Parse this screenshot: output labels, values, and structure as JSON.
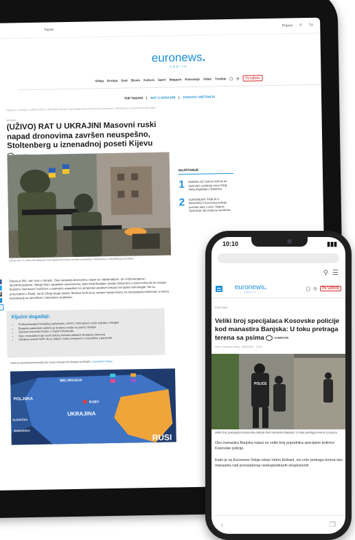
{
  "tablet": {
    "topbar": {
      "lang": "Srpski",
      "login": "Prijava",
      "search_icon": "search-icon",
      "tv": "TV"
    },
    "logo": {
      "text": "euronews",
      "sub": "SRBIJA"
    },
    "nav": [
      "Srbija",
      "Evropa",
      "Svet",
      "Biznis",
      "Kultura",
      "Sport",
      "Magazin",
      "Putovanja",
      "Video",
      "Tvrdnje"
    ],
    "nav_live": "TV UŽIVO",
    "tags": {
      "label": "TOP TAGOVI",
      "items": [
        "RAT U UKRAJINI",
        "KOSOVO I METOHIJA"
      ]
    },
    "breadcrumb": "Naslovna > Evropa > (UŽIVO) RAT U UKRAJINI Masovni ruski napad dronovima završen neuspešno, Stoltenberg u iznenadnoj poseti Kijevu",
    "category": "EVROPA",
    "title": "(UŽIVO) RAT U UKRAJINI Masovni ruski napad dronovima završen neuspešno, Stoltenberg u iznenadnoj poseti Kijevu",
    "comments": "KOMENTARI",
    "author": "Autor: Euronews Srbija",
    "hero_caption": "UŽIVO RAT U UKRAJINI Masovni ruski napad dronovima završen neuspešno, Stoltenberg u iznenadnoj poseti Kijevu",
    "body": "Danas je 581. dan rata u Ukrajini. Dolo nastavlja dronovima, raspe se i diplomatijom, ali i informacijama i dezinformacijama. Takoje Kijev zapadnim saveznicima, kako bodi Banjske, poslan dokument u kome treba da se nastavi drastični \"kamikaze\" korišćeni u podnežni napadima na ukrajinske gradove prepuni evropske tehnologije, što su proizvedeni u Rusiji, nauči Srbija drugo strane. Moskva tvrdi da je neduini napad Kijeva na Sevastopolj realizovan u tesnoj koordinaciji sa američkim i britanskim službama.",
    "events": {
      "heading": "Ključni događaji:",
      "items": [
        "Predsednavajući kamaling parlamentu: NATO i SAD glavni uzrok sukoba u Ukrajini",
        "Bugarski parlament odobrio je dostavu oružja za pomoć Ukrajini",
        "Zatvoren konzulat Finske u Sankt Peterburgu",
        "Kijev iznenadno troje novih šefova ministra odbrane Rustama Umerova",
        "Ukrajina zovede NOP da se uključi i ruske pregovore o navodima o genocidu"
      ]
    },
    "map_link": {
      "text": "Kako je posebna proizvodnji dan ruske invazije na Ukrajinu pročitajte ",
      "link": "u posebnom blogu"
    },
    "map": {
      "labels": [
        "BELORUSIJA",
        "POLJSKA",
        "UKRAJINA",
        "KIJEV",
        "SLOVAČKA",
        "MAĐARSKA",
        "RUSI"
      ]
    },
    "sidebar": {
      "heading": "NAJČITANIJE",
      "items": [
        {
          "num": "1",
          "text": "Nakoliko EU Gamiz trdit da se kosmalni uvođenje mera Srbiji zbog događaja u Banjskoj"
        },
        {
          "num": "2",
          "text": "EURONEWS SRBIJA U BANJSKOJ Kosovska policija pozvala ulaz u selo, Stijanić: Operacija nije potpuno završena"
        }
      ]
    }
  },
  "phone": {
    "time": "10:10",
    "signal": "signal-icon",
    "logo": {
      "text": "euronews",
      "sub": "SRBIJA"
    },
    "live": "TV UŽIVO",
    "category": "POLITIKA",
    "title": "Veliki broj specijalaca Kosovske policije kod manastira Banjska: U toku pretraga terena sa psima",
    "comments": "KOMENTARI",
    "author": "Autor: Euronews Srbija",
    "date": "26/09/2023 - 12:00",
    "caption": "veliki broj specijalaca Kosovske policije kod manastira Banjska: U toku pretraga terena sa psima",
    "photo_label": "POLICE",
    "body": [
      "Oko manastira Banjska nalazi se veliki broj pripadnika specijalne jedinice Kosovske policije.",
      "Kako je za Euronews Srbija rekao Veton Elshani, oni vrše pretragu terena oko manastira radi pronalaženja neeksplodiranih eksplozivnih"
    ]
  }
}
